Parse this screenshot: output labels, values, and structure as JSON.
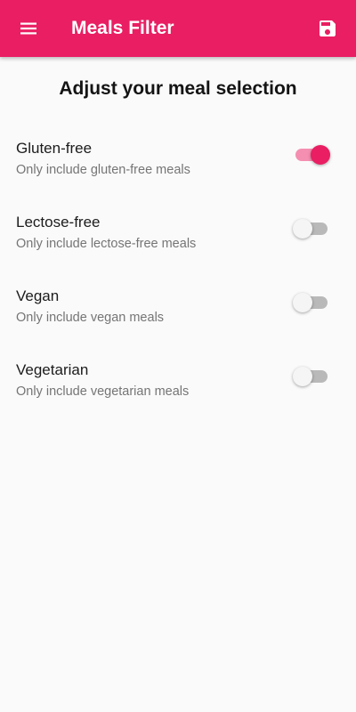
{
  "appbar": {
    "title": "Meals Filter",
    "menu_icon": "menu-icon",
    "save_icon": "save-icon",
    "color": "#e91e63"
  },
  "heading": "Adjust your meal selection",
  "filters": [
    {
      "title": "Gluten-free",
      "subtitle": "Only include gluten-free meals",
      "enabled": true
    },
    {
      "title": "Lectose-free",
      "subtitle": "Only include lectose-free meals",
      "enabled": false
    },
    {
      "title": "Vegan",
      "subtitle": "Only include vegan meals",
      "enabled": false
    },
    {
      "title": "Vegetarian",
      "subtitle": "Only include vegetarian meals",
      "enabled": false
    }
  ]
}
